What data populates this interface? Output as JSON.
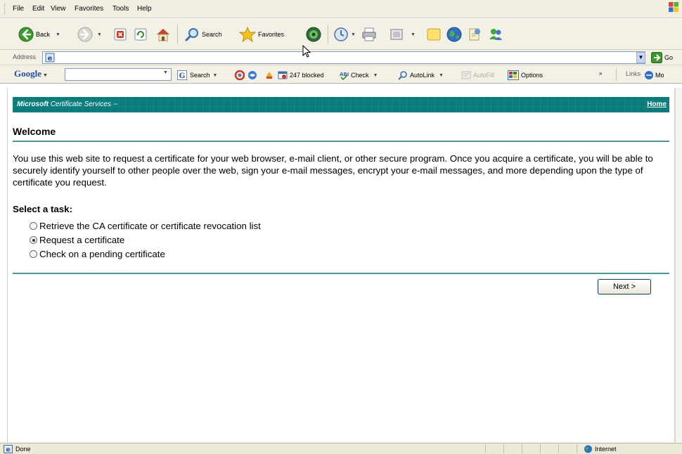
{
  "menubar": {
    "items": [
      "File",
      "Edit",
      "View",
      "Favorites",
      "Tools",
      "Help"
    ]
  },
  "toolbar": {
    "back_label": "Back",
    "search_label": "Search",
    "favorites_label": "Favorites"
  },
  "addressbar": {
    "label": "Address",
    "url": "",
    "go_label": "Go"
  },
  "googlebar": {
    "logo": "Google",
    "search_value": "",
    "search_label": "Search",
    "blocked_label": "247 blocked",
    "check_label": "Check",
    "autolink_label": "AutoLink",
    "autofill_label": "AutoFill",
    "options_label": "Options",
    "links_label": "Links",
    "more_label": "Mo"
  },
  "page": {
    "banner_brand": "Microsoft",
    "banner_title": "Certificate Services",
    "banner_suffix": " --  ",
    "home_link": "Home",
    "title": "Welcome",
    "intro": "You use this web site to request a certificate for your web browser, e-mail client, or other secure program. Once you acquire a certificate, you will be able to securely identify yourself to other people over the web, sign your e-mail messages, encrypt your e-mail messages, and more depending upon the type of certificate you request.",
    "task_heading": "Select a task:",
    "options": [
      {
        "label": "Retrieve the CA certificate or certificate revocation list",
        "checked": false
      },
      {
        "label": "Request a certificate",
        "checked": true
      },
      {
        "label": "Check on a pending certificate",
        "checked": false
      }
    ],
    "next_button": "Next >"
  },
  "statusbar": {
    "status": "Done",
    "zone": "Internet"
  },
  "colors": {
    "banner": "#0a7b7b",
    "rule": "#4a9898",
    "chrome": "#f3f1e6"
  }
}
